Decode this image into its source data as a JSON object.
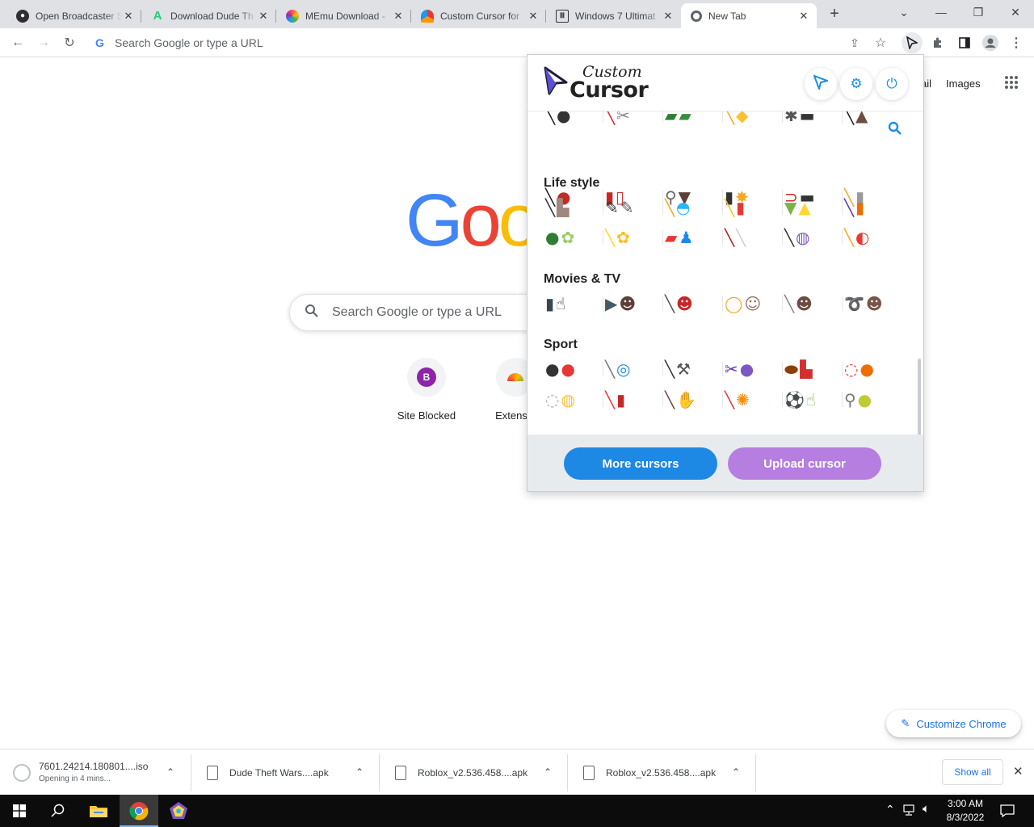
{
  "tabs": [
    {
      "title": "Open Broadcaster S",
      "icon": "obs-icon",
      "color": "#302e31"
    },
    {
      "title": "Download Dude Th",
      "icon": "apkpure-icon",
      "color": "#24cd77"
    },
    {
      "title": "MEmu Download -",
      "icon": "memu-icon",
      "color": "#7e57c2"
    },
    {
      "title": "Custom Cursor for",
      "icon": "custom-cursor-icon",
      "color": "#ff8a00"
    },
    {
      "title": "Windows 7 Ultimat",
      "icon": "archive-icon",
      "color": "#333333"
    },
    {
      "title": "New Tab",
      "icon": "chrome-icon",
      "color": "#5f6368"
    }
  ],
  "toolbar": {
    "omnibox_placeholder": "Search Google or type a URL"
  },
  "page": {
    "links": [
      "ail",
      "Images"
    ],
    "logo": "Goo",
    "search_placeholder": "Search Google or type a URL",
    "shortcuts": [
      {
        "label": "Site Blocked",
        "initial": "B"
      },
      {
        "label": "Extensio"
      }
    ],
    "customize_label": "Customize Chrome"
  },
  "popup": {
    "brand_line1": "Custom",
    "brand_line2": "Cursor",
    "sections": [
      {
        "title": "Life style"
      },
      {
        "title": "Movies & TV"
      },
      {
        "title": "Sport"
      }
    ],
    "more_button": "More cursors",
    "upload_button": "Upload cursor",
    "colors": {
      "more": "#1e88e5",
      "upload": "#b57ee0",
      "accent": "#1a8fe3"
    }
  },
  "downloads": [
    {
      "name": "7601.24214.180801....iso",
      "status": "Opening in 4 mins..."
    },
    {
      "name": "Dude Theft Wars....apk"
    },
    {
      "name": "Roblox_v2.536.458....apk"
    },
    {
      "name": "Roblox_v2.536.458....apk"
    }
  ],
  "downloads_show_all": "Show all",
  "taskbar": {
    "time": "3:00 AM",
    "date": "8/3/2022"
  }
}
